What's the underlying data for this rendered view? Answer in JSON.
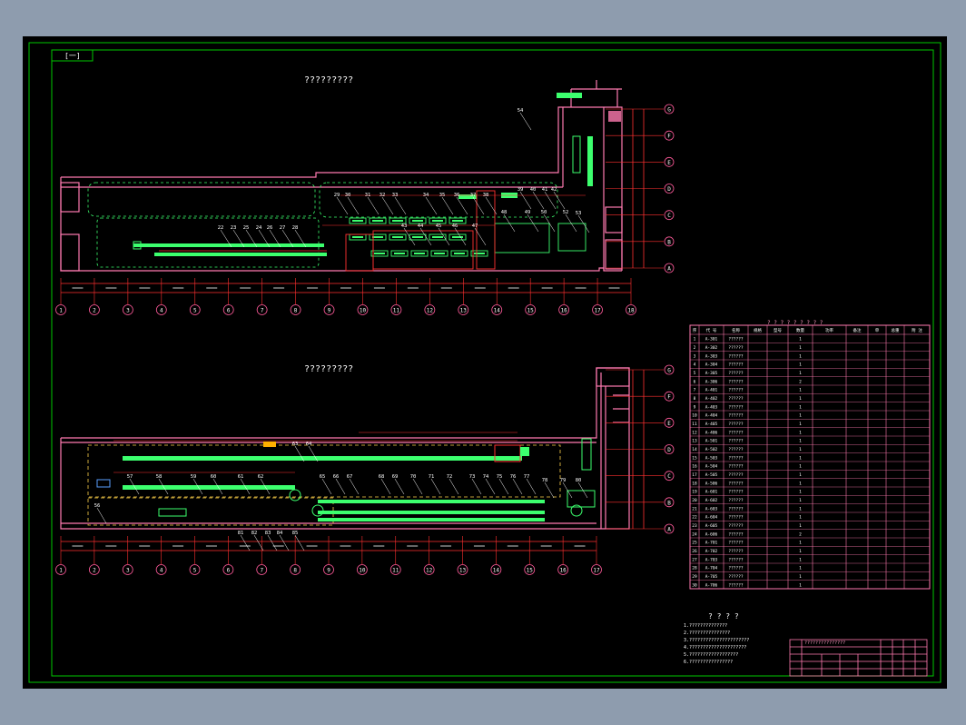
{
  "sheet": {
    "tag": "[一]",
    "plan_top_title": "?????????",
    "plan_bottom_title": "?????????",
    "notes_title": "? ? ? ?",
    "notes": [
      "1.??????????????",
      "2.???????????????",
      "3.??????????????????????",
      "4.?????????????????????",
      "5.??????????????????",
      "6.????????????????"
    ],
    "table_title": "? ? ? ? ? ? ? ? ?",
    "title_block_label": "???????????????"
  },
  "top_plan": {
    "row_labels": [
      "G",
      "F",
      "E",
      "D",
      "C",
      "B",
      "A"
    ],
    "col_labels": [
      "1",
      "2",
      "3",
      "4",
      "5",
      "6",
      "7",
      "8",
      "9",
      "10",
      "11",
      "12",
      "13",
      "14",
      "15",
      "16",
      "17",
      "18"
    ],
    "tags": [
      "22",
      "23",
      "25",
      "24",
      "26",
      "27",
      "28",
      "29",
      "30",
      "31",
      "32",
      "33",
      "34",
      "35",
      "36",
      "37",
      "38",
      "39",
      "40",
      "41",
      "42",
      "43",
      "44",
      "45",
      "46",
      "47",
      "48",
      "49",
      "50",
      "52",
      "53",
      "54"
    ]
  },
  "bottom_plan": {
    "row_labels": [
      "G",
      "F",
      "E",
      "D",
      "C",
      "B",
      "A"
    ],
    "col_labels": [
      "1",
      "2",
      "3",
      "4",
      "5",
      "6",
      "7",
      "8",
      "9",
      "10",
      "11",
      "12",
      "13",
      "14",
      "15",
      "16",
      "17"
    ],
    "tags": [
      "56",
      "57",
      "58",
      "59",
      "60",
      "61",
      "62",
      "63",
      "64",
      "65",
      "66",
      "67",
      "68",
      "69",
      "70",
      "71",
      "72",
      "73",
      "74",
      "75",
      "76",
      "77",
      "78",
      "79",
      "80",
      "81",
      "82",
      "83",
      "84",
      "85"
    ]
  },
  "equipment_table": {
    "columns": [
      "序",
      "代 号",
      "名称",
      "规格",
      "型号",
      "数量",
      "功率",
      "备注",
      "单",
      "总重",
      "附 注"
    ],
    "rows": [
      [
        "1",
        "A-301",
        "??????",
        "",
        "",
        "1",
        "",
        "",
        "",
        "",
        ""
      ],
      [
        "2",
        "A-302",
        "??????",
        "",
        "",
        "1",
        "",
        "",
        "",
        "",
        ""
      ],
      [
        "3",
        "A-303",
        "??????",
        "",
        "",
        "1",
        "",
        "",
        "",
        "",
        ""
      ],
      [
        "4",
        "A-304",
        "??????",
        "",
        "",
        "1",
        "",
        "",
        "",
        "",
        ""
      ],
      [
        "5",
        "A-305",
        "??????",
        "",
        "",
        "1",
        "",
        "",
        "",
        "",
        ""
      ],
      [
        "6",
        "A-306",
        "??????",
        "",
        "",
        "2",
        "",
        "",
        "",
        "",
        ""
      ],
      [
        "7",
        "A-401",
        "??????",
        "",
        "",
        "1",
        "",
        "",
        "",
        "",
        ""
      ],
      [
        "8",
        "A-402",
        "??????",
        "",
        "",
        "1",
        "",
        "",
        "",
        "",
        ""
      ],
      [
        "9",
        "A-403",
        "??????",
        "",
        "",
        "1",
        "",
        "",
        "",
        "",
        ""
      ],
      [
        "10",
        "A-404",
        "??????",
        "",
        "",
        "1",
        "",
        "",
        "",
        "",
        ""
      ],
      [
        "11",
        "A-405",
        "??????",
        "",
        "",
        "1",
        "",
        "",
        "",
        "",
        ""
      ],
      [
        "12",
        "A-406",
        "??????",
        "",
        "",
        "1",
        "",
        "",
        "",
        "",
        ""
      ],
      [
        "13",
        "A-501",
        "??????",
        "",
        "",
        "1",
        "",
        "",
        "",
        "",
        ""
      ],
      [
        "14",
        "A-502",
        "??????",
        "",
        "",
        "1",
        "",
        "",
        "",
        "",
        ""
      ],
      [
        "15",
        "A-503",
        "??????",
        "",
        "",
        "1",
        "",
        "",
        "",
        "",
        ""
      ],
      [
        "16",
        "A-504",
        "??????",
        "",
        "",
        "1",
        "",
        "",
        "",
        "",
        ""
      ],
      [
        "17",
        "A-505",
        "??????",
        "",
        "",
        "1",
        "",
        "",
        "",
        "",
        ""
      ],
      [
        "18",
        "A-506",
        "??????",
        "",
        "",
        "1",
        "",
        "",
        "",
        "",
        ""
      ],
      [
        "19",
        "A-601",
        "??????",
        "",
        "",
        "1",
        "",
        "",
        "",
        "",
        ""
      ],
      [
        "20",
        "A-602",
        "??????",
        "",
        "",
        "1",
        "",
        "",
        "",
        "",
        ""
      ],
      [
        "21",
        "A-603",
        "??????",
        "",
        "",
        "1",
        "",
        "",
        "",
        "",
        ""
      ],
      [
        "22",
        "A-604",
        "??????",
        "",
        "",
        "1",
        "",
        "",
        "",
        "",
        ""
      ],
      [
        "23",
        "A-605",
        "??????",
        "",
        "",
        "1",
        "",
        "",
        "",
        "",
        ""
      ],
      [
        "24",
        "A-606",
        "??????",
        "",
        "",
        "2",
        "",
        "",
        "",
        "",
        ""
      ],
      [
        "25",
        "A-701",
        "??????",
        "",
        "",
        "1",
        "",
        "",
        "",
        "",
        ""
      ],
      [
        "26",
        "A-702",
        "??????",
        "",
        "",
        "1",
        "",
        "",
        "",
        "",
        ""
      ],
      [
        "27",
        "A-703",
        "??????",
        "",
        "",
        "1",
        "",
        "",
        "",
        "",
        ""
      ],
      [
        "28",
        "A-704",
        "??????",
        "",
        "",
        "1",
        "",
        "",
        "",
        "",
        ""
      ],
      [
        "29",
        "A-705",
        "??????",
        "",
        "",
        "1",
        "",
        "",
        "",
        "",
        ""
      ],
      [
        "30",
        "A-706",
        "??????",
        "",
        "",
        "1",
        "",
        "",
        "",
        "",
        ""
      ]
    ]
  },
  "colors": {
    "background": "#000000",
    "frame": "#00c800",
    "wall": "#ff7ab0",
    "equipment": "#3cff6e",
    "dimension": "#ff3030",
    "leader": "#ffffff",
    "grid_bubble": "#ff5a9a",
    "viewport_bg": "#8e9cae"
  }
}
